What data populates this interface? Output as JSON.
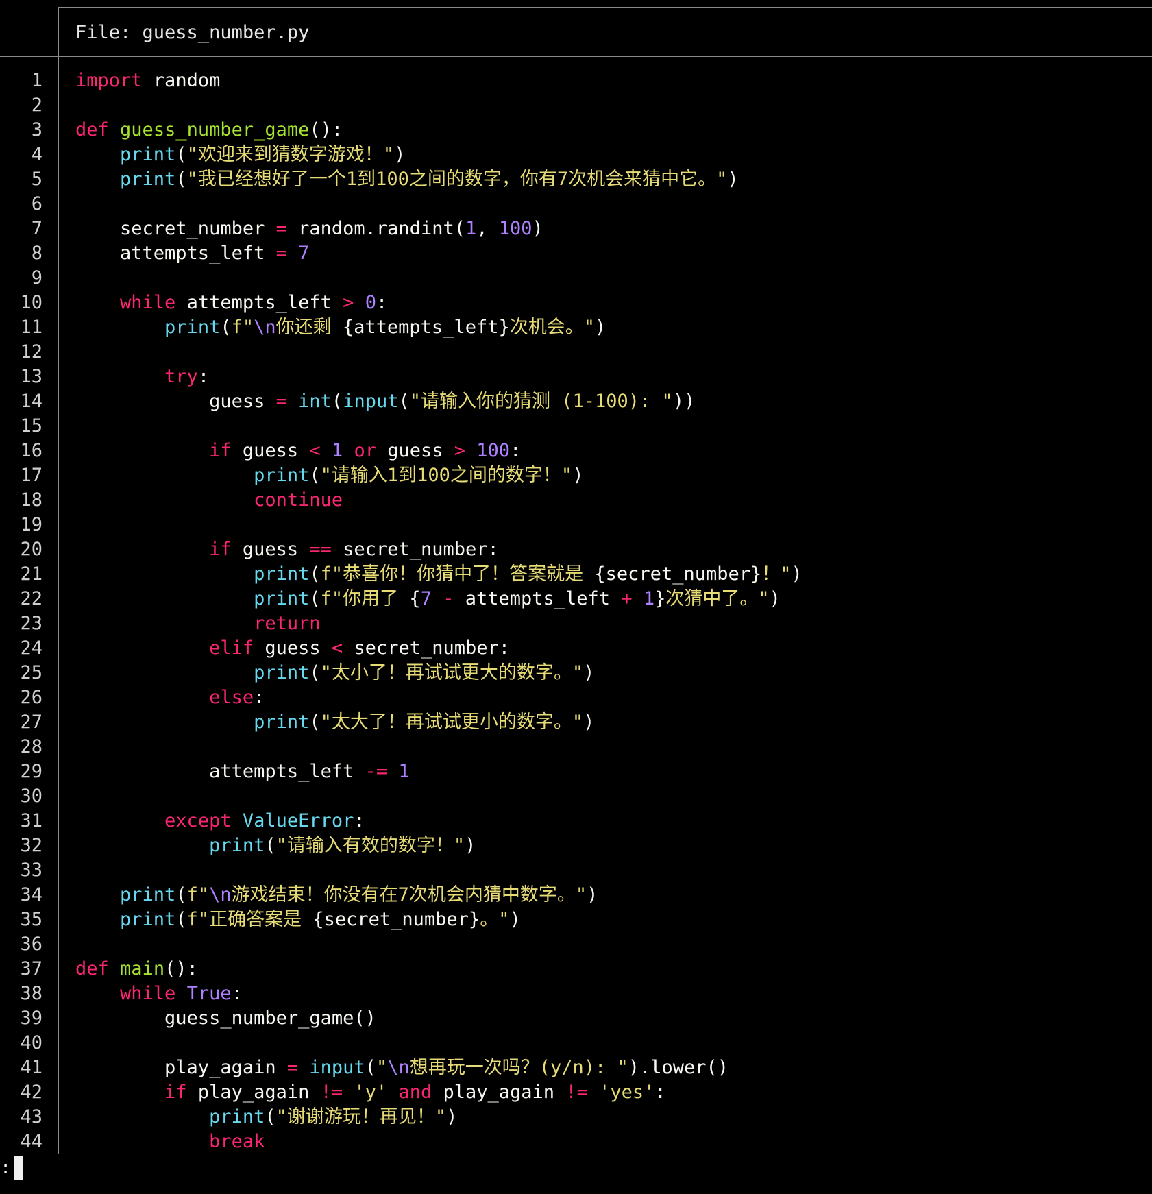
{
  "header": {
    "file_title": "File: guess_number.py"
  },
  "colors": {
    "keyword": "#f92672",
    "function": "#a6e22e",
    "builtin": "#66d9ef",
    "string": "#e6db74",
    "number": "#ae81ff",
    "text": "#f8f8f2"
  },
  "prompt": {
    "text": ":"
  },
  "code_lines": [
    [
      [
        "kw",
        "import"
      ],
      [
        "",
        " random"
      ]
    ],
    [],
    [
      [
        "kw",
        "def"
      ],
      [
        "",
        " "
      ],
      [
        "fn",
        "guess_number_game"
      ],
      [
        "",
        "():"
      ]
    ],
    [
      [
        "",
        "    "
      ],
      [
        "bi",
        "print"
      ],
      [
        "",
        "("
      ],
      [
        "st",
        "\"欢迎来到猜数字游戏！\""
      ],
      [
        "",
        ")"
      ]
    ],
    [
      [
        "",
        "    "
      ],
      [
        "bi",
        "print"
      ],
      [
        "",
        "("
      ],
      [
        "st",
        "\"我已经想好了一个1到100之间的数字，你有7次机会来猜中它。\""
      ],
      [
        "",
        ")"
      ]
    ],
    [],
    [
      [
        "",
        "    secret_number "
      ],
      [
        "op",
        "="
      ],
      [
        "",
        " random.randint("
      ],
      [
        "nu",
        "1"
      ],
      [
        "",
        ", "
      ],
      [
        "nu",
        "100"
      ],
      [
        "",
        ")"
      ]
    ],
    [
      [
        "",
        "    attempts_left "
      ],
      [
        "op",
        "="
      ],
      [
        "",
        " "
      ],
      [
        "nu",
        "7"
      ]
    ],
    [],
    [
      [
        "",
        "    "
      ],
      [
        "kw",
        "while"
      ],
      [
        "",
        " attempts_left "
      ],
      [
        "op",
        ">"
      ],
      [
        "",
        " "
      ],
      [
        "nu",
        "0"
      ],
      [
        "",
        ":"
      ]
    ],
    [
      [
        "",
        "        "
      ],
      [
        "bi",
        "print"
      ],
      [
        "",
        "("
      ],
      [
        "st",
        "f\""
      ],
      [
        "nu",
        "\\n"
      ],
      [
        "st",
        "你还剩 "
      ],
      [
        "",
        "{attempts_left}"
      ],
      [
        "st",
        "次机会。\""
      ],
      [
        "",
        ")"
      ]
    ],
    [],
    [
      [
        "",
        "        "
      ],
      [
        "kw",
        "try"
      ],
      [
        "",
        ":"
      ]
    ],
    [
      [
        "",
        "            guess "
      ],
      [
        "op",
        "="
      ],
      [
        "",
        " "
      ],
      [
        "bi",
        "int"
      ],
      [
        "",
        "("
      ],
      [
        "bi",
        "input"
      ],
      [
        "",
        "("
      ],
      [
        "st",
        "\"请输入你的猜测 (1-100): \""
      ],
      [
        "",
        "))"
      ]
    ],
    [],
    [
      [
        "",
        "            "
      ],
      [
        "kw",
        "if"
      ],
      [
        "",
        " guess "
      ],
      [
        "op",
        "<"
      ],
      [
        "",
        " "
      ],
      [
        "nu",
        "1"
      ],
      [
        "",
        " "
      ],
      [
        "kw",
        "or"
      ],
      [
        "",
        " guess "
      ],
      [
        "op",
        ">"
      ],
      [
        "",
        " "
      ],
      [
        "nu",
        "100"
      ],
      [
        "",
        ":"
      ]
    ],
    [
      [
        "",
        "                "
      ],
      [
        "bi",
        "print"
      ],
      [
        "",
        "("
      ],
      [
        "st",
        "\"请输入1到100之间的数字！\""
      ],
      [
        "",
        ")"
      ]
    ],
    [
      [
        "",
        "                "
      ],
      [
        "kw",
        "continue"
      ]
    ],
    [],
    [
      [
        "",
        "            "
      ],
      [
        "kw",
        "if"
      ],
      [
        "",
        " guess "
      ],
      [
        "op",
        "=="
      ],
      [
        "",
        " secret_number:"
      ]
    ],
    [
      [
        "",
        "                "
      ],
      [
        "bi",
        "print"
      ],
      [
        "",
        "("
      ],
      [
        "st",
        "f\"恭喜你！你猜中了！答案就是 "
      ],
      [
        "",
        "{secret_number}"
      ],
      [
        "st",
        "！\""
      ],
      [
        "",
        ")"
      ]
    ],
    [
      [
        "",
        "                "
      ],
      [
        "bi",
        "print"
      ],
      [
        "",
        "("
      ],
      [
        "st",
        "f\"你用了 "
      ],
      [
        "",
        "{"
      ],
      [
        "nu",
        "7"
      ],
      [
        "",
        " "
      ],
      [
        "op",
        "-"
      ],
      [
        "",
        " attempts_left "
      ],
      [
        "op",
        "+"
      ],
      [
        "",
        " "
      ],
      [
        "nu",
        "1"
      ],
      [
        "",
        "}"
      ],
      [
        "st",
        "次猜中了。\""
      ],
      [
        "",
        ")"
      ]
    ],
    [
      [
        "",
        "                "
      ],
      [
        "kw",
        "return"
      ]
    ],
    [
      [
        "",
        "            "
      ],
      [
        "kw",
        "elif"
      ],
      [
        "",
        " guess "
      ],
      [
        "op",
        "<"
      ],
      [
        "",
        " secret_number:"
      ]
    ],
    [
      [
        "",
        "                "
      ],
      [
        "bi",
        "print"
      ],
      [
        "",
        "("
      ],
      [
        "st",
        "\"太小了！再试试更大的数字。\""
      ],
      [
        "",
        ")"
      ]
    ],
    [
      [
        "",
        "            "
      ],
      [
        "kw",
        "else"
      ],
      [
        "",
        ":"
      ]
    ],
    [
      [
        "",
        "                "
      ],
      [
        "bi",
        "print"
      ],
      [
        "",
        "("
      ],
      [
        "st",
        "\"太大了！再试试更小的数字。\""
      ],
      [
        "",
        ")"
      ]
    ],
    [],
    [
      [
        "",
        "            attempts_left "
      ],
      [
        "op",
        "-="
      ],
      [
        "",
        " "
      ],
      [
        "nu",
        "1"
      ]
    ],
    [],
    [
      [
        "",
        "        "
      ],
      [
        "kw",
        "except"
      ],
      [
        "",
        " "
      ],
      [
        "bi",
        "ValueError"
      ],
      [
        "",
        ":"
      ]
    ],
    [
      [
        "",
        "            "
      ],
      [
        "bi",
        "print"
      ],
      [
        "",
        "("
      ],
      [
        "st",
        "\"请输入有效的数字！\""
      ],
      [
        "",
        ")"
      ]
    ],
    [],
    [
      [
        "",
        "    "
      ],
      [
        "bi",
        "print"
      ],
      [
        "",
        "("
      ],
      [
        "st",
        "f\""
      ],
      [
        "nu",
        "\\n"
      ],
      [
        "st",
        "游戏结束！你没有在7次机会内猜中数字。\""
      ],
      [
        "",
        ")"
      ]
    ],
    [
      [
        "",
        "    "
      ],
      [
        "bi",
        "print"
      ],
      [
        "",
        "("
      ],
      [
        "st",
        "f\"正确答案是 "
      ],
      [
        "",
        "{secret_number}"
      ],
      [
        "st",
        "。\""
      ],
      [
        "",
        ")"
      ]
    ],
    [],
    [
      [
        "kw",
        "def"
      ],
      [
        "",
        " "
      ],
      [
        "fn",
        "main"
      ],
      [
        "",
        "():"
      ]
    ],
    [
      [
        "",
        "    "
      ],
      [
        "kw",
        "while"
      ],
      [
        "",
        " "
      ],
      [
        "cn",
        "True"
      ],
      [
        "",
        ":"
      ]
    ],
    [
      [
        "",
        "        guess_number_game()"
      ]
    ],
    [],
    [
      [
        "",
        "        play_again "
      ],
      [
        "op",
        "="
      ],
      [
        "",
        " "
      ],
      [
        "bi",
        "input"
      ],
      [
        "",
        "("
      ],
      [
        "st",
        "\""
      ],
      [
        "nu",
        "\\n"
      ],
      [
        "st",
        "想再玩一次吗？(y/n): \""
      ],
      [
        "",
        ").lower()"
      ]
    ],
    [
      [
        "",
        "        "
      ],
      [
        "kw",
        "if"
      ],
      [
        "",
        " play_again "
      ],
      [
        "op",
        "!="
      ],
      [
        "",
        " "
      ],
      [
        "st",
        "'y'"
      ],
      [
        "",
        " "
      ],
      [
        "kw",
        "and"
      ],
      [
        "",
        " play_again "
      ],
      [
        "op",
        "!="
      ],
      [
        "",
        " "
      ],
      [
        "st",
        "'yes'"
      ],
      [
        "",
        ":"
      ]
    ],
    [
      [
        "",
        "            "
      ],
      [
        "bi",
        "print"
      ],
      [
        "",
        "("
      ],
      [
        "st",
        "\"谢谢游玩！再见！\""
      ],
      [
        "",
        ")"
      ]
    ],
    [
      [
        "",
        "            "
      ],
      [
        "kw",
        "break"
      ]
    ]
  ]
}
